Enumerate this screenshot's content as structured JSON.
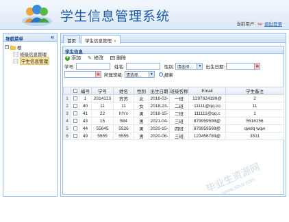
{
  "header": {
    "title": "学生信息管理系统",
    "current_user_label": "当前用户:",
    "user_name": "su",
    "logout_label": "退出登录"
  },
  "sidebar": {
    "title": "导航菜单",
    "collapse_icon": "double-chevron-left-icon",
    "root_label": "根",
    "items": [
      {
        "label": "班级信息管理",
        "selected": false
      },
      {
        "label": "学生信息管理",
        "selected": true
      }
    ]
  },
  "tabs": [
    {
      "label": "首页",
      "active": false
    },
    {
      "label": "学生信息管理",
      "active": true,
      "closable": true,
      "close_glyph": "×"
    }
  ],
  "panel": {
    "title": "学生信息",
    "toolbar": {
      "add_label": "添加",
      "edit_label": "修改",
      "delete_label": "删除"
    },
    "search": {
      "student_no_label": "学号:",
      "name_label": "姓名:",
      "gender_label": "性别:",
      "gender_value": "请选择...",
      "birthday_label": "出生日期:",
      "class_label": "所属班级:",
      "class_value": "请选择...",
      "search_label": "搜索"
    }
  },
  "grid": {
    "columns": [
      "",
      "编号",
      "学号",
      "姓名",
      "性别",
      "出生日期",
      "班级名称",
      "Email",
      "学生备注"
    ],
    "rows": [
      {
        "n": "1",
        "id": "1",
        "no": "2014123",
        "name": "苏苏",
        "gender": "女",
        "birthday": "2018-03-",
        "class": "一班",
        "email": "1297824199@",
        "note": "2"
      },
      {
        "n": "2",
        "id": "40",
        "no": "11",
        "name": "11",
        "gender": "女",
        "birthday": "2018-23-",
        "class": "二班",
        "email": "11111@qq.co",
        "note": "11"
      },
      {
        "n": "3",
        "id": "41",
        "no": "22",
        "name": "h'h'x",
        "gender": "男",
        "birthday": "2018-15-",
        "class": "二班",
        "email": "111111@qq.c",
        "note": "1"
      },
      {
        "n": "4",
        "id": "43",
        "no": "15",
        "name": "584",
        "gender": "男",
        "birthday": "2021-04-",
        "class": "三班",
        "email": "879959598@",
        "note": "5516156"
      },
      {
        "n": "5",
        "id": "44",
        "no": "55645",
        "name": "5526",
        "gender": "男",
        "birthday": "2020-15-",
        "class": "四班",
        "email": "879959598@",
        "note": "qwdq wqw"
      },
      {
        "n": "6",
        "id": "49",
        "no": "5555",
        "name": "5555",
        "gender": "男",
        "birthday": "2020-06-",
        "class": "三班",
        "email": "123456789@",
        "note": "3511"
      }
    ]
  },
  "watermark": {
    "main": "毕业生资源网",
    "sub": "www.sbvv.com"
  }
}
